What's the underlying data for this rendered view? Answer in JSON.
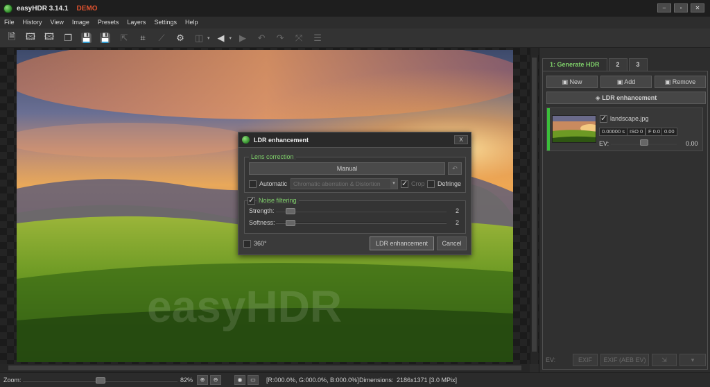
{
  "app": {
    "title": "easyHDR 3.14.1",
    "demo": "DEMO"
  },
  "window_buttons": [
    "–",
    "▫",
    "✕"
  ],
  "menu": [
    "File",
    "History",
    "View",
    "Image",
    "Presets",
    "Layers",
    "Settings",
    "Help"
  ],
  "toolbar": {
    "icons": [
      "open-image-icon",
      "add-image-icon",
      "add-image-alt-icon",
      "batch-icon",
      "save-icon",
      "save-as-icon",
      "export-icon",
      "crop-icon",
      "straighten-icon",
      "settings-icon",
      "compare-icon",
      "navigate-back-icon",
      "navigate-forward-icon",
      "undo-icon",
      "redo-icon",
      "reset-icon",
      "layers-icon"
    ]
  },
  "dialog": {
    "title": "LDR enhancement",
    "close": "X",
    "lens": {
      "title": "Lens correction",
      "manual_label": "Manual",
      "automatic_label": "Automatic",
      "combo_value": "Chromatic aberration & Distortion",
      "crop_label": "Crop",
      "defringe_label": "Defringe"
    },
    "noise": {
      "title": "Noise filtering",
      "strength_label": "Strength:",
      "strength_value": "2",
      "softness_label": "Softness:",
      "softness_value": "2"
    },
    "option_360": "360°",
    "ok_label": "LDR enhancement",
    "cancel_label": "Cancel",
    "slider_positions": {
      "strength": 0.06,
      "softness": 0.06
    }
  },
  "panel": {
    "tabs": [
      "1: Generate HDR",
      "2",
      "3"
    ],
    "new_label": "New",
    "add_label": "Add",
    "remove_label": "Remove",
    "ldr_label": "LDR enhancement",
    "image": {
      "filename": "landscape.jpg",
      "shutter": "0.00000 s",
      "iso": "ISO 0",
      "fnum": "F 0.0",
      "ev_badge": "0.00",
      "ev_label": "EV:",
      "ev_value": "0.00",
      "ev_slider": 0.5
    },
    "footer": {
      "ev_label": "EV:",
      "exif": "EXIF",
      "exif_aeb": "EXIF (AEB EV)"
    }
  },
  "status": {
    "zoom_label": "Zoom:",
    "zoom_value": "82%",
    "zoom_fraction": 0.5,
    "pixel": "[R:000.0%, G:000.0%, B:000.0%]",
    "dimensions_label": "Dimensions:",
    "dimensions_value": "2186x1371 [3.0 MPix]"
  }
}
